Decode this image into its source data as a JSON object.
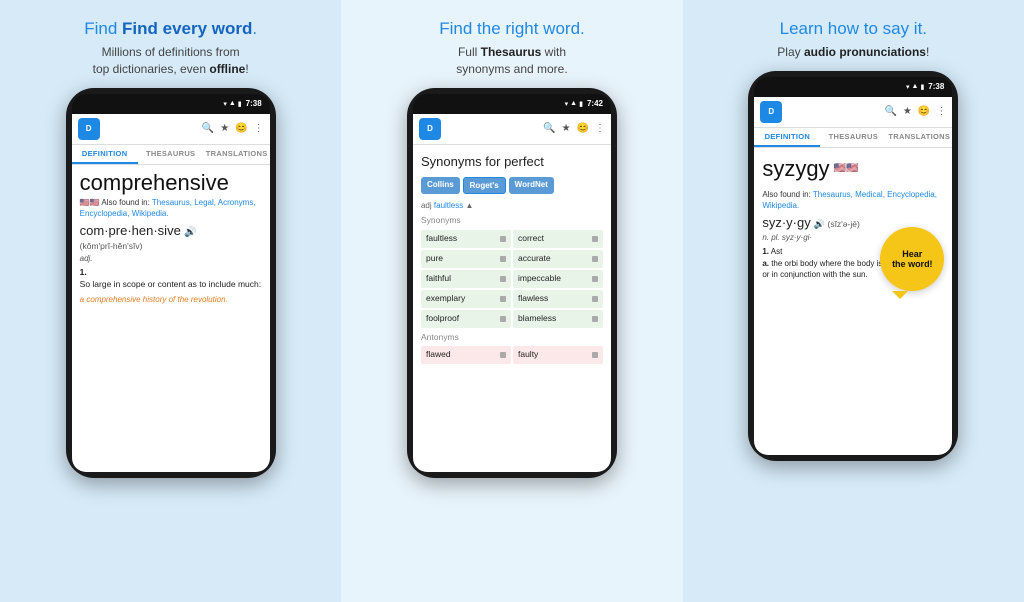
{
  "panels": [
    {
      "id": "left",
      "title_prefix": "Find ",
      "title_bold": "every word",
      "title_suffix": ".",
      "subtitle": "Millions of definitions from top dictionaries, even ",
      "subtitle_bold": "offline",
      "subtitle_suffix": "!",
      "phone": {
        "time": "7:38",
        "tabs": [
          "DEFINITION",
          "THESAURUS",
          "TRANSLATIONS"
        ],
        "active_tab": 0,
        "word": "comprehensive",
        "also_found_prefix": "Also found in: ",
        "also_found_links": [
          "Thesaurus,",
          "Legal,",
          "Acronyms,",
          "Encyclopedia,",
          "Wikipedia."
        ],
        "pronunciation": "com·pre·hen·sive",
        "phonetic": "(kŏm'prĭ-hĕn'sĭv)",
        "pos": "adj.",
        "def_num": "1.",
        "def_text": "So large in scope or content as to include much:",
        "example": "a comprehensive history of the revolution."
      }
    },
    {
      "id": "mid",
      "title": "Find the right word.",
      "subtitle_prefix": "Full ",
      "subtitle_bold": "Thesaurus",
      "subtitle_suffix": " with synonyms and more.",
      "phone": {
        "time": "7:42",
        "thesaurus_title": "Synonyms for perfect",
        "sources": [
          "Collins",
          "Roget's",
          "WordNet"
        ],
        "adj_label": "adj ",
        "adj_word": "faultless",
        "section_synonyms": "Synonyms",
        "synonyms": [
          [
            "faultless",
            "correct"
          ],
          [
            "pure",
            "accurate"
          ],
          [
            "faithful",
            "impeccable"
          ],
          [
            "exemplary",
            "flawless"
          ],
          [
            "foolproof",
            "blameless"
          ]
        ],
        "section_antonyms": "Antonyms",
        "antonyms": [
          [
            "flawed",
            "faulty"
          ]
        ]
      }
    },
    {
      "id": "right",
      "title": "Learn how to say it.",
      "subtitle_prefix": "Play ",
      "subtitle_bold": "audio pronunciations",
      "subtitle_suffix": "!",
      "phone": {
        "time": "7:38",
        "tabs": [
          "DEFINITION",
          "THESAURUS",
          "TRANSLATIONS"
        ],
        "active_tab": 0,
        "word": "syzygy",
        "also_found_prefix": "Also found in: ",
        "also_found_links": [
          "Thesaurus,",
          "Medical,",
          "Encyclopedia,",
          "Wikipedia."
        ],
        "pronunciation": "syz·y·gy",
        "phonetic": "(sĭz'ə-jē)",
        "pos": "n. pl. syz·y·gi·",
        "def_num": "1.",
        "def_sub": "Ast",
        "def_sub_b": "a.",
        "def_text1": "the orbi",
        "def_text2": "body where the body is in opposition to or in conjunction with the sun.",
        "hear_label": "Hear\nthe word!"
      }
    }
  ]
}
